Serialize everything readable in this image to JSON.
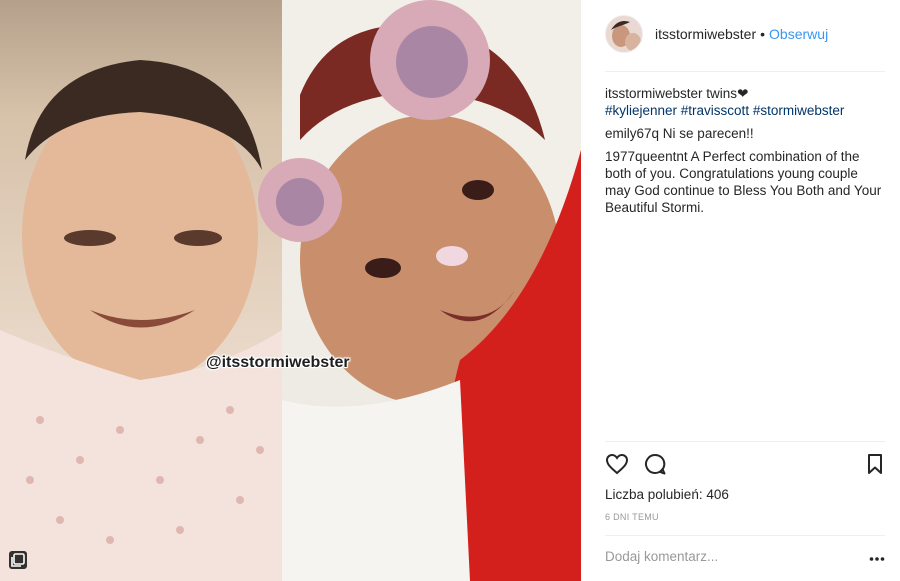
{
  "post": {
    "watermark": "@itsstormiwebster"
  },
  "header": {
    "username": "itsstormiwebster",
    "separator": "•",
    "follow_label": "Obserwuj"
  },
  "comments": [
    {
      "user": "itsstormiwebster",
      "text": "twins",
      "heart": "❤",
      "hashtags": "#kyliejenner #travisscott #stormiwebster"
    },
    {
      "user": "emily67q",
      "text": "Ni se parecen!!"
    },
    {
      "user": "1977queentnt",
      "text": "A Perfect combination of the both of you. Congratulations young couple may God continue to Bless You Both and Your Beautiful Stormi."
    }
  ],
  "actions": {
    "likes_label": "Liczba polubień: 406",
    "date": "6 DNI TEMU",
    "add_comment_placeholder": "Dodaj komentarz..."
  },
  "icons": [
    "like-icon",
    "comment-icon",
    "save-icon",
    "more-icon",
    "multiple-photos-icon"
  ],
  "colors": {
    "link": "#3897f0",
    "hashtag": "#003569",
    "muted": "#999999",
    "border": "#efefef"
  }
}
